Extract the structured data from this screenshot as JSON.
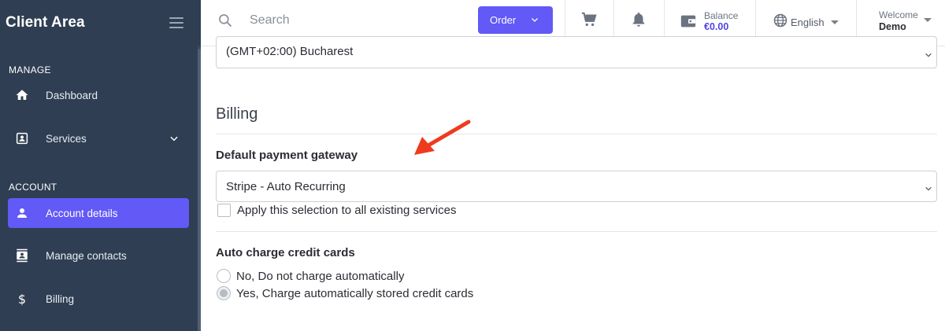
{
  "sidebar": {
    "brand": "Client Area",
    "sections": [
      {
        "label": "MANAGE"
      },
      {
        "label": "ACCOUNT"
      }
    ],
    "items": [
      {
        "label": "Dashboard",
        "icon": "home-icon"
      },
      {
        "label": "Services",
        "icon": "services-icon"
      },
      {
        "label": "Account details",
        "icon": "user-icon",
        "active": true
      },
      {
        "label": "Manage contacts",
        "icon": "contacts-icon"
      },
      {
        "label": "Billing",
        "icon": "dollar-icon"
      }
    ]
  },
  "topbar": {
    "search_placeholder": "Search",
    "order_label": "Order",
    "balance_label": "Balance",
    "balance_value": "€0.00",
    "language": "English",
    "welcome_label": "Welcome",
    "user_name": "Demo"
  },
  "main": {
    "timezone_value": "(GMT+02:00) Bucharest",
    "billing_title": "Billing",
    "gateway_label": "Default payment gateway",
    "gateway_value": "Stripe - Auto Recurring",
    "apply_all_label": "Apply this selection to all existing services",
    "auto_charge_label": "Auto charge credit cards",
    "auto_charge_options": [
      {
        "label": "No, Do not charge automatically",
        "checked": false
      },
      {
        "label": "Yes, Charge automatically stored credit cards",
        "checked": true
      }
    ]
  },
  "colors": {
    "sidebar_bg": "#2f3e52",
    "accent": "#6259f6",
    "balance": "#4f46e5",
    "annotation_arrow": "#f03a1e"
  }
}
